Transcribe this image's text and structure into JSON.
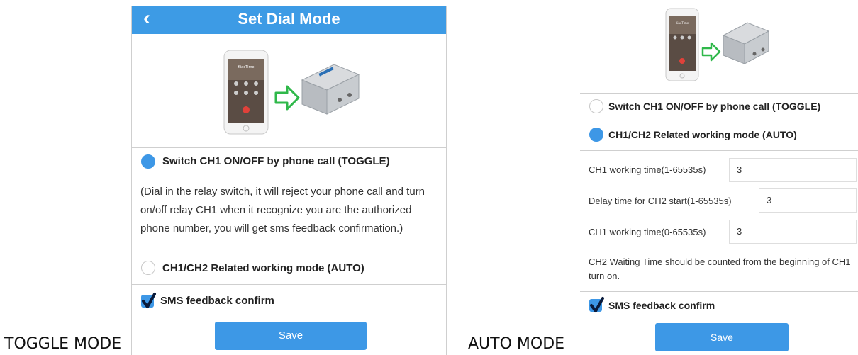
{
  "captions": {
    "left": "TOGGLE MODE",
    "right": "AUTO MODE"
  },
  "toggle_screen": {
    "title": "Set Dial Mode",
    "back_icon": "chevron-left-icon",
    "phone_screen_name": "KiaoTime",
    "option_toggle": {
      "label": "Switch CH1 ON/OFF by phone call (TOGGLE)",
      "selected": true
    },
    "toggle_description": "(Dial in the relay switch, it will reject your phone call and turn on/off relay CH1 when it recognize you are the authorized phone number, you will get sms feedback confirmation.)",
    "option_auto": {
      "label": "CH1/CH2 Related working mode (AUTO)",
      "selected": false
    },
    "sms_feedback": {
      "label": "SMS feedback confirm",
      "checked": true
    },
    "save_label": "Save"
  },
  "auto_screen": {
    "phone_screen_name": "KiaoTime",
    "option_toggle": {
      "label": "Switch CH1 ON/OFF by phone call (TOGGLE)",
      "selected": false
    },
    "option_auto": {
      "label": "CH1/CH2 Related working mode (AUTO)",
      "selected": true
    },
    "fields": [
      {
        "label": "CH1 working time(1-65535s)",
        "value": "3"
      },
      {
        "label": "Delay time for CH2 start(1-65535s)",
        "value": "3"
      },
      {
        "label": "CH1 working time(0-65535s)",
        "value": "3"
      }
    ],
    "note": "CH2 Waiting Time should be counted from the beginning of CH1 turn on.",
    "sms_feedback": {
      "label": "SMS feedback confirm",
      "checked": true
    },
    "save_label": "Save"
  },
  "colors": {
    "accent": "#3d9be5",
    "arrow": "#2fb84a"
  }
}
